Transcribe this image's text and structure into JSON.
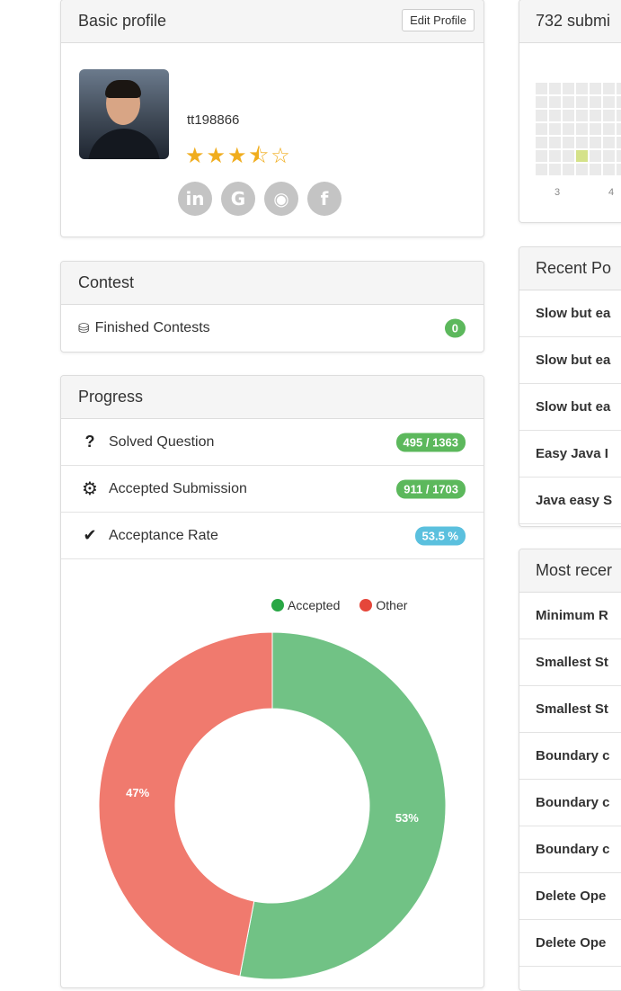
{
  "basic_profile": {
    "title": "Basic profile",
    "edit_button": "Edit Profile",
    "username": "tt198866",
    "rating_stars": 3.5,
    "stars_display": "★★★",
    "star_half": "⯪",
    "star_empty": "☆",
    "social_icons": [
      {
        "name": "linkedin-icon",
        "glyph": "in"
      },
      {
        "name": "google-icon",
        "glyph": "G"
      },
      {
        "name": "github-icon",
        "glyph": "◉"
      },
      {
        "name": "facebook-icon",
        "glyph": "f"
      }
    ]
  },
  "contest": {
    "title": "Contest",
    "finished_label": "Finished Contests",
    "finished_count": "0"
  },
  "progress": {
    "title": "Progress",
    "rows": [
      {
        "icon": "question-icon",
        "glyph": "?",
        "label": "Solved Question",
        "value": "495 / 1363",
        "color": "green"
      },
      {
        "icon": "gear-icon",
        "glyph": "⚙",
        "label": "Accepted Submission",
        "value": "911 / 1703",
        "color": "green"
      },
      {
        "icon": "check-icon",
        "glyph": "✔",
        "label": "Acceptance Rate",
        "value": "53.5 %",
        "color": "blue"
      }
    ]
  },
  "chart_data": {
    "type": "pie",
    "categories": [
      "Accepted",
      "Other"
    ],
    "values": [
      53,
      47
    ],
    "labels": [
      "53%",
      "47%"
    ],
    "colors": [
      "#71c285",
      "#f07a6e"
    ],
    "legend_colors": [
      "#29a745",
      "#e5463a"
    ],
    "legend_position": "top"
  },
  "submissions": {
    "title": "732 submi",
    "calendar_labels": [
      "3",
      "4"
    ]
  },
  "recent_posts": {
    "title": "Recent Po",
    "items": [
      "Slow but ea",
      "Slow but ea",
      "Slow but ea",
      "Easy Java I",
      "Java easy S"
    ]
  },
  "most_recent": {
    "title": "Most recer",
    "items": [
      "Minimum R",
      "Smallest St",
      "Smallest St",
      "Boundary c",
      "Boundary c",
      "Boundary c",
      "Delete Ope",
      "Delete Ope"
    ]
  }
}
